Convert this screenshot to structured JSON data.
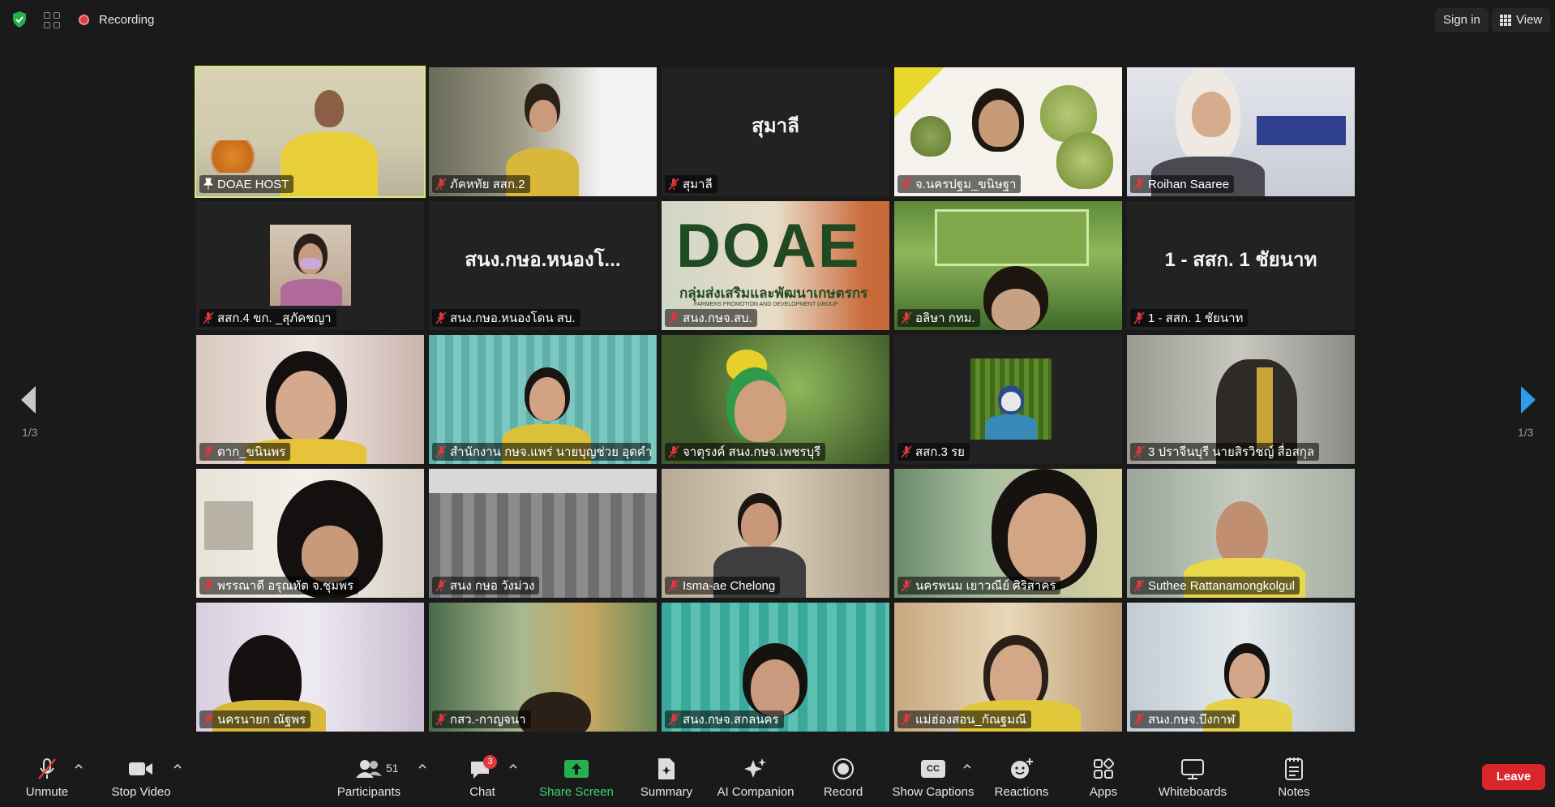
{
  "topbar": {
    "recording_label": "Recording",
    "signin_label": "Sign in",
    "view_label": "View",
    "shield_color": "#23b14d"
  },
  "pagination": {
    "left": "1/3",
    "right": "1/3"
  },
  "tiles": [
    {
      "name": "DOAE HOST",
      "center": "",
      "host": true
    },
    {
      "name": "ภัคหทัย สสก.2",
      "center": ""
    },
    {
      "name": "สุมาลี",
      "center": "สุมาลี"
    },
    {
      "name": "จ.นครปฐม_ขนิษฐา",
      "center": ""
    },
    {
      "name": "Roihan Saaree",
      "center": ""
    },
    {
      "name": "สสก.4 ขก. _สุภัคชญา",
      "center": ""
    },
    {
      "name": "สนง.กษอ.หนองโดน สบ.",
      "center": "สนง.กษอ.หนองโ..."
    },
    {
      "name": "สนง.กษจ.สบ.",
      "center": ""
    },
    {
      "name": "อลิษา กทม.",
      "center": ""
    },
    {
      "name": "1 - สสก. 1 ชัยนาท",
      "center": "1 - สสก. 1 ชัยนาท"
    },
    {
      "name": "ตาก_ขนินพร",
      "center": ""
    },
    {
      "name": "สำนักงาน กษจ.แพร่ นายบุญช่วย อุดคำมี",
      "center": ""
    },
    {
      "name": "จาตุรงค์ สนง.กษจ.เพชรบุรี",
      "center": ""
    },
    {
      "name": "สสก.3 รย",
      "center": ""
    },
    {
      "name": "3 ปราจีนบุรี นายสิรวิชญ์ สื่อสกุล",
      "center": ""
    },
    {
      "name": "พรรณาดี อรุณทัต จ.ชุมพร",
      "center": ""
    },
    {
      "name": "สนง กษอ วังม่วง",
      "center": ""
    },
    {
      "name": "Isma-ae Chelong",
      "center": ""
    },
    {
      "name": "นครพนม เยาวณีย์ ศิริสาคร",
      "center": ""
    },
    {
      "name": "Suthee Rattanamongkolgul",
      "center": ""
    },
    {
      "name": "นครนายก ณัฐพร",
      "center": ""
    },
    {
      "name": "กสว.-กาญจนา",
      "center": ""
    },
    {
      "name": "สนง.กษจ.สกลนคร",
      "center": ""
    },
    {
      "name": "แม่ฮ่องสอน_กัณฐมณี",
      "center": ""
    },
    {
      "name": "สนง.กษจ.บึงกาฬ",
      "center": ""
    }
  ],
  "doae_logo": {
    "text": "DOAE",
    "subtitle": "กลุ่มส่งเสริมและพัฒนาเกษตรกร",
    "small": "FARMERS PROMOTION AND DEVELOPMENT GROUP"
  },
  "toolbar": {
    "unmute": "Unmute",
    "stop_video": "Stop Video",
    "participants": "Participants",
    "participants_count": "51",
    "chat": "Chat",
    "chat_badge": "3",
    "share_screen": "Share Screen",
    "summary": "Summary",
    "ai_companion": "AI Companion",
    "record": "Record",
    "show_captions": "Show Captions",
    "reactions": "Reactions",
    "apps": "Apps",
    "whiteboards": "Whiteboards",
    "notes": "Notes",
    "leave": "Leave",
    "cc_text": "CC"
  }
}
